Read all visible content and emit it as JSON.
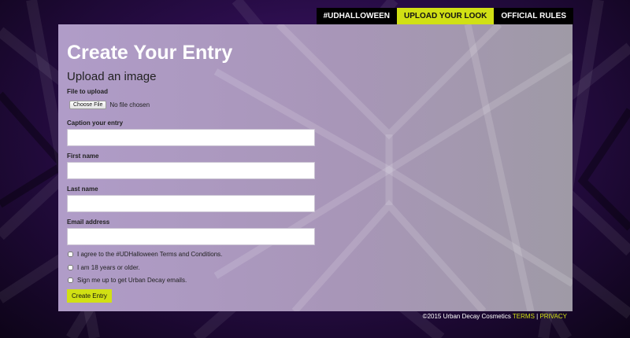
{
  "nav": {
    "items": [
      {
        "label": "#UDHALLOWEEN",
        "active": false
      },
      {
        "label": "UPLOAD YOUR LOOK",
        "active": true
      },
      {
        "label": "OFFICIAL RULES",
        "active": false
      }
    ]
  },
  "form": {
    "title": "Create Your Entry",
    "subtitle": "Upload an image",
    "file_label": "File to upload",
    "file_button": "Choose File",
    "file_status": "No file chosen",
    "caption_label": "Caption your entry",
    "first_name_label": "First name",
    "last_name_label": "Last name",
    "email_label": "Email address",
    "checkboxes": [
      "I agree to the #UDHalloween Terms and Conditions.",
      "I am 18 years or older.",
      "Sign me up to get Urban Decay emails."
    ],
    "submit_label": "Create Entry"
  },
  "footer": {
    "copyright": "©2015 Urban Decay Cosmetics",
    "terms_label": "TERMS",
    "separator": "|",
    "privacy_label": "PRIVACY"
  },
  "colors": {
    "accent": "#d1e014",
    "nav_bg": "#000000",
    "panel_bg": "#a896b8"
  }
}
